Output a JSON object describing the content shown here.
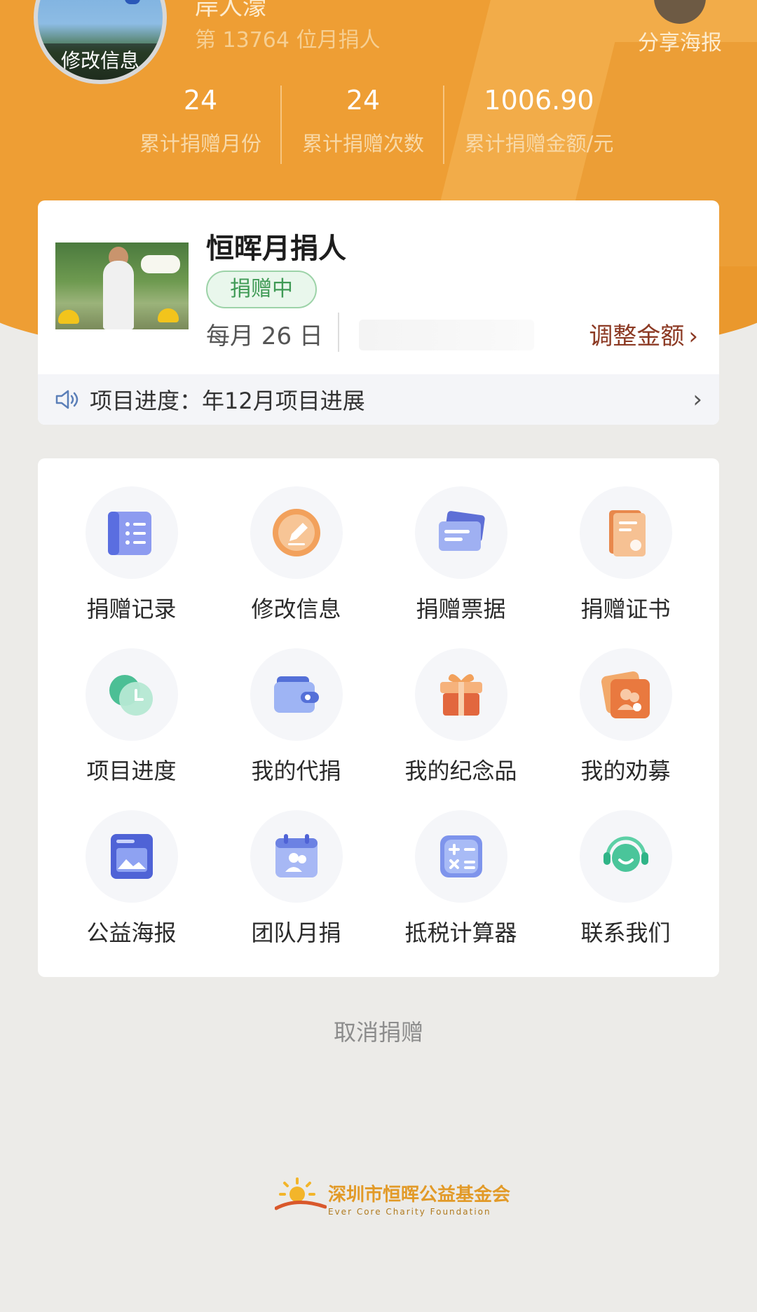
{
  "header": {
    "user_name": "岸人濛",
    "rank_text": "第 13764 位月捐人",
    "avatar_edit_label": "修改信息",
    "share_label": "分享海报",
    "stats": [
      {
        "value": "24",
        "label": "累计捐赠月份"
      },
      {
        "value": "24",
        "label": "累计捐赠次数"
      },
      {
        "value": "1006.90",
        "label": "累计捐赠金额/元"
      }
    ]
  },
  "project": {
    "title": "恒晖月捐人",
    "status": "捐赠中",
    "date": "每月 26 日",
    "adjust_label": "调整金额",
    "progress_text": "项目进度：年12月项目进展"
  },
  "grid": [
    {
      "label": "捐赠记录",
      "icon": "donation-record-icon"
    },
    {
      "label": "修改信息",
      "icon": "edit-info-icon"
    },
    {
      "label": "捐赠票据",
      "icon": "donation-receipt-icon"
    },
    {
      "label": "捐赠证书",
      "icon": "certificate-icon"
    },
    {
      "label": "项目进度",
      "icon": "project-progress-icon"
    },
    {
      "label": "我的代捐",
      "icon": "wallet-icon"
    },
    {
      "label": "我的纪念品",
      "icon": "gift-icon"
    },
    {
      "label": "我的劝募",
      "icon": "fundraise-icon"
    },
    {
      "label": "公益海报",
      "icon": "poster-icon"
    },
    {
      "label": "团队月捐",
      "icon": "team-calendar-icon"
    },
    {
      "label": "抵税计算器",
      "icon": "calculator-icon"
    },
    {
      "label": "联系我们",
      "icon": "customer-service-icon"
    }
  ],
  "cancel_label": "取消捐赠",
  "footer": {
    "org_name_cn": "深圳市恒晖公益基金会",
    "org_name_en": "Ever Core Charity Foundation"
  },
  "colors": {
    "header_orange": "#ee9e34",
    "status_green": "#3f9a55",
    "adjust_red": "#8c3a24"
  }
}
